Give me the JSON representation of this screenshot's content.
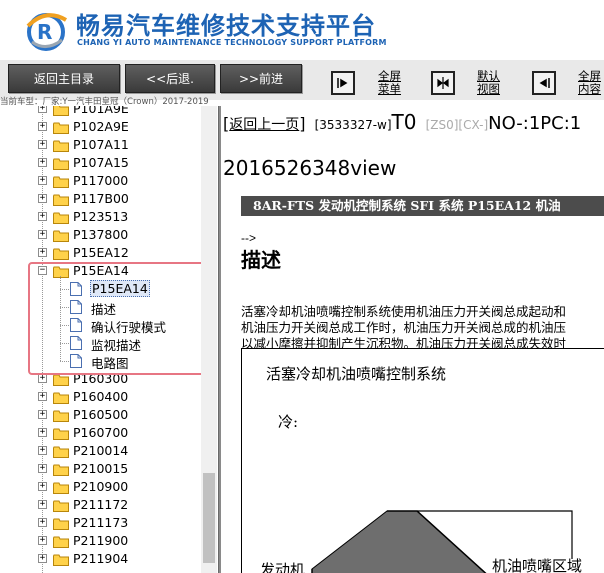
{
  "header": {
    "title": "畅易汽车维修技术支持平台",
    "subtitle": "CHANG YI AUTO MAINTENANCE TECHNOLOGY SUPPORT PLATFORM"
  },
  "toolbar": {
    "home_label": "返回主目录",
    "back_label": "<<后退.",
    "forward_label": ">>前进",
    "fullscreen_menu": "全屏菜单",
    "default_view": "默认视图",
    "fullscreen_content": "全屏内容"
  },
  "vehicle_info": "当前车型：厂家:Y一汽丰田皇冠（Crown）2017-2019",
  "tree": {
    "folders_top": [
      "P101A9E",
      "P102A9E",
      "P107A11",
      "P107A15",
      "P117000",
      "P117B00",
      "P123513",
      "P137800",
      "P15EA12"
    ],
    "expanded_folder": "P15EA14",
    "children": [
      "P15EA14",
      "描述",
      "确认行驶模式",
      "监视描述",
      "电路图"
    ],
    "folders_bottom": [
      "P160300",
      "P160400",
      "P160500",
      "P160700",
      "P210014",
      "P210015",
      "P210900",
      "P211172",
      "P211173",
      "P211900",
      "P211904"
    ]
  },
  "content": {
    "back_link": "返回上一页",
    "bracket_open": "[",
    "bracket_close": "]",
    "doc_id": "[3533327-w]",
    "t0": "T0",
    "zs_tag": "[ZS0][CX-]",
    "no_pc": "NO-:1PC:1",
    "view_id": "2016526348view",
    "title_bar": "8AR-FTS 发动机控制系统  SFI 系统  P15EA12  机油",
    "arrow": "-->",
    "heading": "描述",
    "paragraphs": [
      "活塞冷却机油喷嘴控制系统使用机油压力开关阀总成起动和",
      "机油压力开关阀总成工作时，机油压力开关阀总成的机油压",
      "以减小摩擦并抑制产生沉积物。机油压力开关阀总成失效时"
    ],
    "figure": {
      "title": "活塞冷却机油喷嘴控制系统",
      "cold": "冷:",
      "engine": "发动机",
      "zone": "机油喷嘴区域"
    }
  },
  "colors": {
    "brand_blue": "#1d63b4",
    "highlight": "#e77683",
    "title_bar": "#4c4c4c"
  }
}
